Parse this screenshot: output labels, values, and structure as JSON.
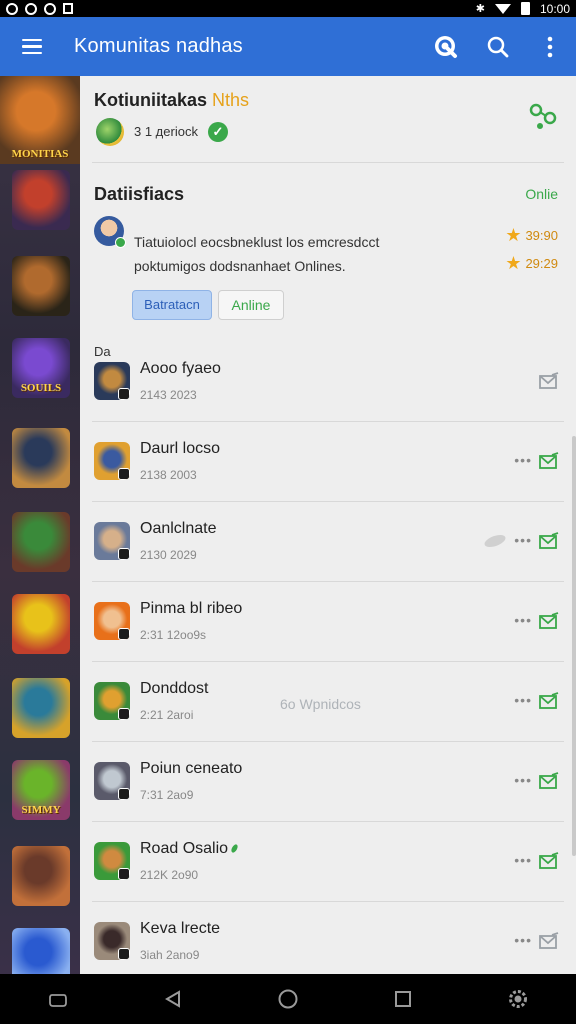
{
  "status_bar": {
    "time": "10:00",
    "icons": [
      "notification-icon",
      "notification-icon",
      "notification-icon",
      "message-icon",
      "bluetooth-icon",
      "wifi-icon",
      "battery-icon"
    ]
  },
  "app_bar": {
    "title": "Komunitas nadhas",
    "actions": [
      "app-logo-search-icon",
      "search-icon",
      "more-vert-icon"
    ],
    "color": "#2f6fd6"
  },
  "rail": {
    "items": [
      {
        "caption": "MONITIAS",
        "colors": [
          "#d6782a",
          "#5a3a20"
        ]
      },
      {
        "caption": "",
        "colors": [
          "#c2402c",
          "#3a2a50"
        ]
      },
      {
        "caption": "",
        "colors": [
          "#b06a2e",
          "#2a2418"
        ]
      },
      {
        "caption": "SOUILS",
        "colors": [
          "#7a4ad0",
          "#3a2a60"
        ]
      },
      {
        "caption": "",
        "colors": [
          "#2a3a5a",
          "#c28a40"
        ]
      },
      {
        "caption": "",
        "colors": [
          "#3a8a3a",
          "#6a3a2a"
        ]
      },
      {
        "caption": "",
        "colors": [
          "#e8c21a",
          "#c2402c"
        ]
      },
      {
        "caption": "",
        "colors": [
          "#2a7a9a",
          "#d6a22a"
        ]
      },
      {
        "caption": "SIMMY",
        "colors": [
          "#6ab42a",
          "#8a3a6a"
        ]
      },
      {
        "caption": "",
        "colors": [
          "#6a3a2a",
          "#c2703a"
        ]
      },
      {
        "caption": "",
        "colors": [
          "#2a5ad0",
          "#8ab0f0"
        ]
      }
    ]
  },
  "header_card": {
    "title": "Kotiuniitakas",
    "title_highlight": "Nths",
    "subtitle": "3 1 дeriock",
    "verified": "✓"
  },
  "featured": {
    "title": "Datiisfiacs",
    "status": "Onlie",
    "line1": "Tiatuiolocl eocsbneklust los emcresdcct",
    "line2": "poktumigos dodsnanhaet Onlines.",
    "rating1": "39:90",
    "rating2": "29:29",
    "button_primary": "Batratacn",
    "button_secondary": "Anline"
  },
  "section_label": "Da",
  "watermark": "6o Wpnidcos",
  "chats": [
    {
      "name": "Aooo fyaeo",
      "time": "2143 2023",
      "dots": false,
      "mail_color": "#9aa0a6",
      "avatar": [
        "#2a3a5a",
        "#c28a40"
      ]
    },
    {
      "name": "Daurl locso",
      "time": "2138 2003",
      "dots": true,
      "mail_color": "#3aa84a",
      "avatar": [
        "#e0a030",
        "#3a5aa0"
      ]
    },
    {
      "name": "Oanlclnate",
      "time": "2130 2029",
      "dots": true,
      "mail_color": "#3aa84a",
      "avatar": [
        "#6a7a9a",
        "#d6b08a"
      ]
    },
    {
      "name": "Pinma bl ribeo",
      "time": "2:31 12oo9s",
      "dots": true,
      "mail_color": "#3aa84a",
      "avatar": [
        "#e8701a",
        "#f0c090"
      ]
    },
    {
      "name": "Donddost",
      "time": "2:21 2aroi",
      "dots": true,
      "mail_color": "#3aa84a",
      "avatar": [
        "#3a8a3a",
        "#e0a030"
      ]
    },
    {
      "name": "Poiun ceneato",
      "time": "7:31 2ao9",
      "dots": true,
      "mail_color": "#3aa84a",
      "avatar": [
        "#5a5a6a",
        "#c0c8d0"
      ]
    },
    {
      "name": "Road Osalio",
      "time": "212K 2o90",
      "dots": true,
      "mail_color": "#3aa84a",
      "avatar": [
        "#3a9a3a",
        "#d08a40"
      ],
      "online": true
    },
    {
      "name": "Keva lrecte",
      "time": "3iah 2ano9",
      "dots": true,
      "mail_color": "#9aa0a6",
      "avatar": [
        "#9a8a7a",
        "#3a2a2a"
      ]
    }
  ],
  "nav_bar": {
    "icons": [
      "recents-shape-icon",
      "back-icon",
      "home-icon",
      "overview-icon",
      "settings-icon"
    ]
  }
}
